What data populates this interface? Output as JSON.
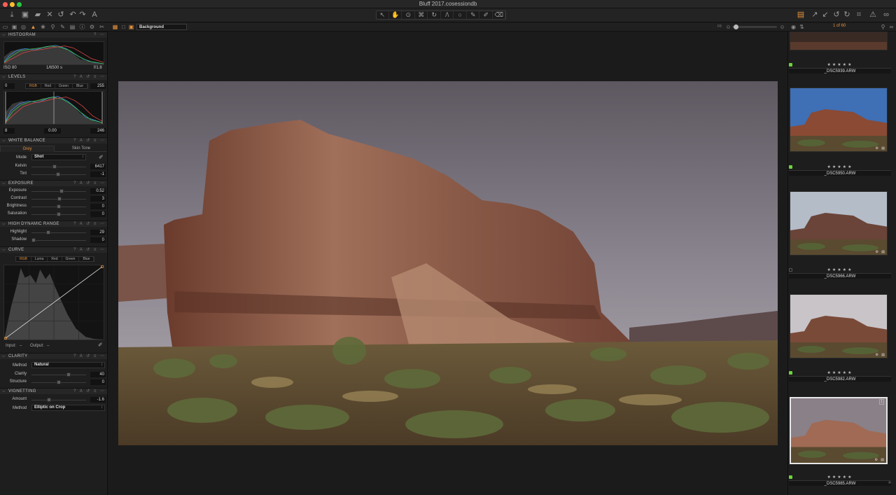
{
  "window": {
    "title": "Bluff 2017.cosessiondb"
  },
  "toolbar": {
    "left_icons": [
      "import-icon",
      "camera-icon",
      "folder-icon",
      "delete-icon",
      "reset-icon",
      "undo-icon",
      "redo-icon",
      "text-icon"
    ],
    "center_icons": [
      "cursor-icon",
      "pan-icon",
      "loupe-icon",
      "crop-icon",
      "rotate-icon",
      "keystone-icon",
      "spot-icon",
      "brush-icon",
      "color-picker-icon",
      "eraser-icon"
    ],
    "right_icons": [
      "stack-icon",
      "export-icon",
      "compare-icon",
      "rotate-left-icon",
      "rotate-right-icon",
      "grid-icon",
      "warning-icon",
      "glasses-icon"
    ]
  },
  "viewer": {
    "selector_value": "Background",
    "photo_counter": "1 of 60",
    "fn_label": "F8"
  },
  "histogram": {
    "title": "HISTOGRAM",
    "iso": "ISO 80",
    "shutter": "1/6500 s",
    "aperture": "f/1.8"
  },
  "levels": {
    "title": "LEVELS",
    "channels": [
      "RGB",
      "Red",
      "Green",
      "Blue"
    ],
    "selected_channel": "RGB",
    "input_low": "0",
    "input_high": "255",
    "output_low": "8",
    "midpoint": "0.00",
    "output_high": "246"
  },
  "white_balance": {
    "title": "WHITE BALANCE",
    "tabs": [
      "Grey",
      "Skin Tone"
    ],
    "selected_tab": "Grey",
    "mode_label": "Mode",
    "mode_value": "Shot",
    "kelvin_label": "Kelvin",
    "kelvin_value": "6417",
    "kelvin_level": 0.42,
    "tint_label": "Tint",
    "tint_value": "-1",
    "tint_level": 0.49
  },
  "exposure": {
    "title": "EXPOSURE",
    "sliders": [
      {
        "label": "Exposure",
        "value": "0.52",
        "level": 0.55
      },
      {
        "label": "Contrast",
        "value": "3",
        "level": 0.51
      },
      {
        "label": "Brightness",
        "value": "0",
        "level": 0.5
      },
      {
        "label": "Saturation",
        "value": "0",
        "level": 0.5
      }
    ]
  },
  "hdr": {
    "title": "HIGH DYNAMIC RANGE",
    "sliders": [
      {
        "label": "Highlight",
        "value": "29",
        "level": 0.29
      },
      {
        "label": "Shadow",
        "value": "0",
        "level": 0.0
      }
    ]
  },
  "curve": {
    "title": "CURVE",
    "channels": [
      "RGB",
      "Luma",
      "Red",
      "Green",
      "Blue"
    ],
    "selected_channel": "RGB",
    "input_label": "Input:",
    "input_value": "–",
    "output_label": "Output:",
    "output_value": "–"
  },
  "clarity": {
    "title": "CLARITY",
    "method_label": "Method",
    "method_value": "Natural",
    "sliders": [
      {
        "label": "Clarity",
        "value": "40",
        "level": 0.7
      },
      {
        "label": "Structure",
        "value": "0",
        "level": 0.5
      }
    ]
  },
  "vignetting": {
    "title": "VIGNETTING",
    "amount_label": "Amount",
    "amount_value": "-1.6",
    "amount_level": 0.3,
    "method_label": "Method",
    "method_value": "Elliptic on Crop"
  },
  "browser": {
    "items": [
      {
        "filename": "_DSC5939.ARW",
        "stars": "★★★★★",
        "tagged": true
      },
      {
        "filename": "_DSC5950.ARW",
        "stars": "★★★★★",
        "tagged": true
      },
      {
        "filename": "_DSC5966.ARW",
        "stars": "★★★★★",
        "tagged": false
      },
      {
        "filename": "_DSC5982.ARW",
        "stars": "★★★★★",
        "tagged": true
      },
      {
        "filename": "_DSC5985.ARW",
        "stars": "★★★★★",
        "tagged": true
      }
    ],
    "selected_index": 4,
    "selected_badge": "1"
  },
  "colors": {
    "accent": "#e8913a",
    "tag_green": "#6dd23c"
  }
}
